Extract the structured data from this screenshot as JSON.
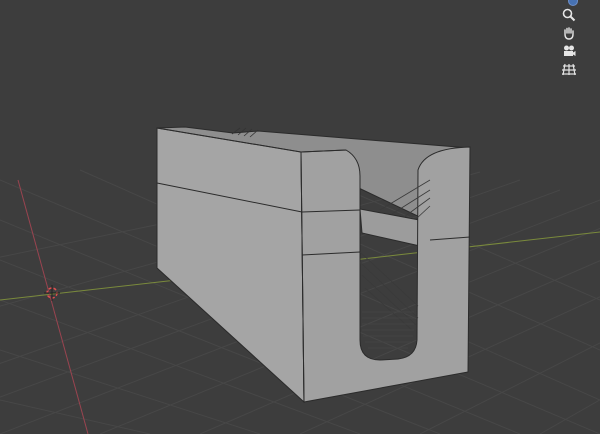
{
  "viewport": {
    "background_color": "#3d3d3d",
    "grid_color": "#474747",
    "x_axis_color": "#7a8a3c",
    "y_axis_color": "#9a4450",
    "object_color": "#a3a3a3",
    "edge_color": "#2b2b2b"
  },
  "navigation_gizmo": {
    "axis_color": "#4772b3",
    "buttons": [
      {
        "icon": "zoom-icon"
      },
      {
        "icon": "hand-pan-icon"
      },
      {
        "icon": "camera-icon"
      },
      {
        "icon": "grid-toggle-icon"
      }
    ]
  }
}
